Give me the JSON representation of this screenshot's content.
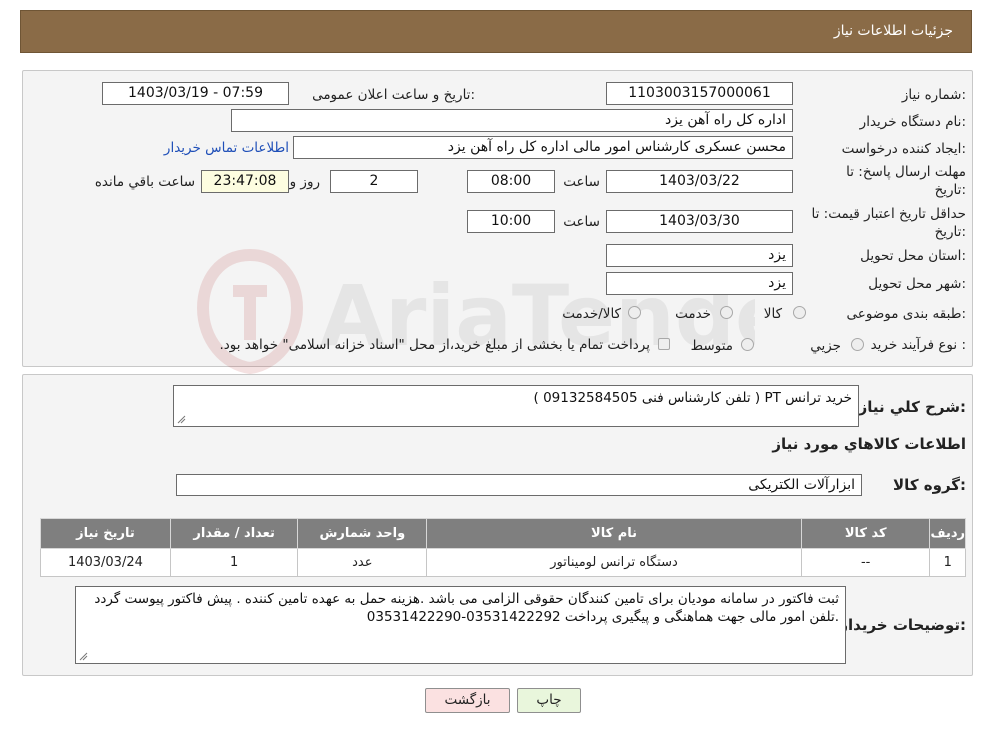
{
  "header": {
    "title": "جزئیات اطلاعات نیاز"
  },
  "form": {
    "need_number_label": "شماره نیاز:",
    "need_number": "1103003157000061",
    "announce_label": "تاریخ و ساعت اعلان عمومی:",
    "announce_value": "1403/03/19 - 07:59",
    "buyer_org_label": "نام دستگاه خریدار:",
    "buyer_org": "اداره کل راه آهن یزد",
    "requester_label": "ایجاد کننده درخواست:",
    "requester": "محسن عسکری کارشناس امور مالی اداره کل راه آهن یزد",
    "contact_link": "اطلاعات تماس خریدار",
    "deadline_label_1": "مهلت ارسال پاسخ: تا",
    "deadline_label_2": "تاریخ:",
    "deadline_date": "1403/03/22",
    "time_label": "ساعت",
    "deadline_time": "08:00",
    "days_value": "2",
    "days_label": "روز و",
    "remaining_time": "23:47:08",
    "remaining_label": "ساعت باقي مانده",
    "validity_label_1": "حداقل تاریخ اعتبار قیمت: تا",
    "validity_label_2": "تاریخ:",
    "validity_date": "1403/03/30",
    "validity_time": "10:00",
    "province_label": "استان محل تحویل:",
    "province": "یزد",
    "city_label": "شهر محل تحویل:",
    "city": "یزد",
    "category_label": "طبقه بندی موضوعی:",
    "category_options": [
      "کالا",
      "خدمت",
      "کالا/خدمت"
    ],
    "process_label": "نوع فرآیند خرید :",
    "process_options": [
      "جزیي",
      "متوسط"
    ],
    "process_note": "پرداخت تمام یا بخشی از مبلغ خرید،از محل \"اسناد خزانه اسلامی\" خواهد بود."
  },
  "details": {
    "description_label": "شرح کلي نیاز:",
    "description": "خرید ترانس PT ( تلفن کارشناس فنی 09132584505 )",
    "goods_info_title": "اطلاعات کالاهاي مورد نیاز",
    "goods_group_label": "گروه کالا:",
    "goods_group": "ابزارآلات الکتریکی",
    "table": {
      "headers": [
        "ردیف",
        "کد کالا",
        "نام کالا",
        "واحد شمارش",
        "تعداد / مقدار",
        "تاریخ نیاز"
      ],
      "rows": [
        [
          "1",
          "--",
          "دستگاه ترانس لومیناتور",
          "عدد",
          "1",
          "1403/03/24"
        ]
      ]
    },
    "buyer_notes_label": "توضیحات خریدار:",
    "buyer_notes": "ثبت فاکتور در سامانه مودیان برای تامین کنندگان حقوقی الزامی می باشد .هزینه حمل به عهده تامین کننده . پیش فاکتور پیوست گردد .تلفن امور مالی جهت هماهنگی و پیگیری پرداخت 03531422292-03531422290"
  },
  "buttons": {
    "print": "چاپ",
    "back": "بازگشت"
  },
  "watermark": {
    "text": "AriaTender.neT"
  },
  "colors": {
    "header_bg": "#8a6b47",
    "back_button_bg": "#fbe1e1",
    "print_button_bg": "#e9f6dc",
    "link": "#1f4fb8"
  }
}
